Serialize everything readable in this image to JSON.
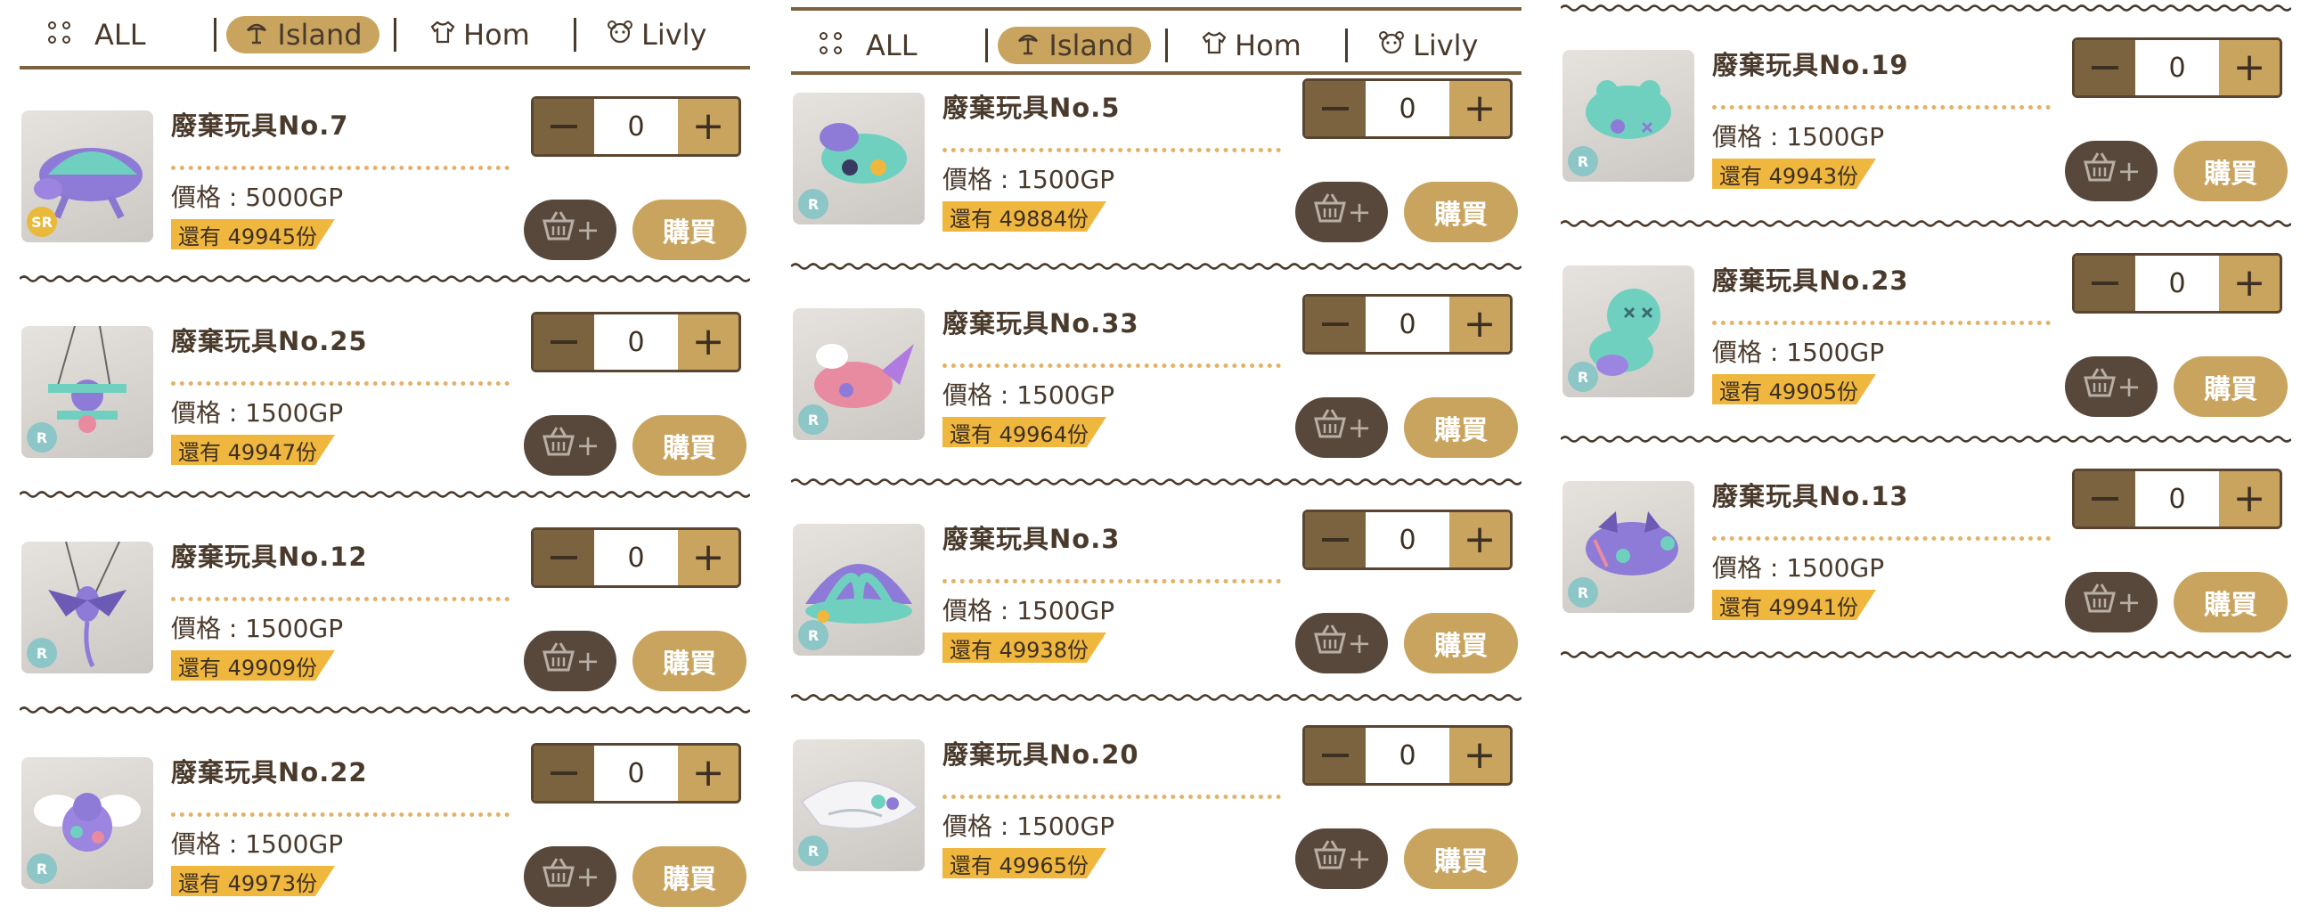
{
  "tabs": {
    "all": "ALL",
    "island": "Island",
    "hom": "Hom",
    "livly": "Livly"
  },
  "labels": {
    "buy": "購買",
    "cart_plus": "+"
  },
  "colors": {
    "accent": "#c9a45f",
    "dark": "#58483b",
    "stock_tag": "#efb73e",
    "rarity_R": "#8cc6c6",
    "rarity_SR": "#e8b93a"
  },
  "columns": [
    {
      "items": [
        {
          "name": "廢棄玩具No.7",
          "price": "價格 : 5000GP",
          "stock": "還有 49945份",
          "rarity": "SR",
          "qty": "0"
        },
        {
          "name": "廢棄玩具No.25",
          "price": "價格 : 1500GP",
          "stock": "還有 49947份",
          "rarity": "R",
          "qty": "0"
        },
        {
          "name": "廢棄玩具No.12",
          "price": "價格 : 1500GP",
          "stock": "還有 49909份",
          "rarity": "R",
          "qty": "0"
        },
        {
          "name": "廢棄玩具No.22",
          "price": "價格 : 1500GP",
          "stock": "還有 49973份",
          "rarity": "R",
          "qty": "0"
        }
      ]
    },
    {
      "items": [
        {
          "name": "廢棄玩具No.5",
          "price": "價格 : 1500GP",
          "stock": "還有 49884份",
          "rarity": "R",
          "qty": "0"
        },
        {
          "name": "廢棄玩具No.33",
          "price": "價格 : 1500GP",
          "stock": "還有 49964份",
          "rarity": "R",
          "qty": "0"
        },
        {
          "name": "廢棄玩具No.3",
          "price": "價格 : 1500GP",
          "stock": "還有 49938份",
          "rarity": "R",
          "qty": "0"
        },
        {
          "name": "廢棄玩具No.20",
          "price": "價格 : 1500GP",
          "stock": "還有 49965份",
          "rarity": "R",
          "qty": "0"
        }
      ]
    },
    {
      "items": [
        {
          "name": "廢棄玩具No.19",
          "price": "價格 : 1500GP",
          "stock": "還有 49943份",
          "rarity": "R",
          "qty": "0"
        },
        {
          "name": "廢棄玩具No.23",
          "price": "價格 : 1500GP",
          "stock": "還有 49905份",
          "rarity": "R",
          "qty": "0"
        },
        {
          "name": "廢棄玩具No.13",
          "price": "價格 : 1500GP",
          "stock": "還有 49941份",
          "rarity": "R",
          "qty": "0"
        }
      ]
    }
  ]
}
